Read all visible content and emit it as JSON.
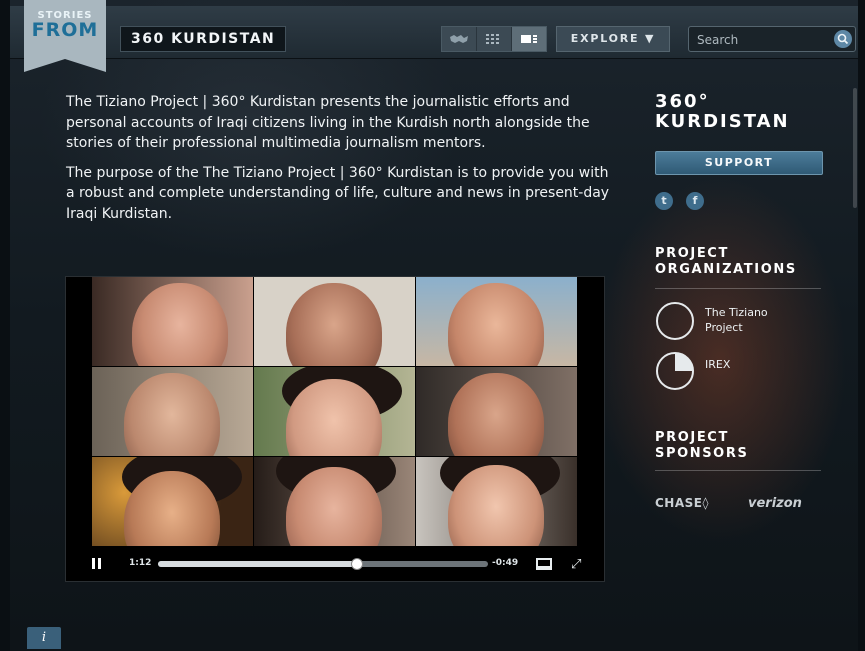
{
  "header": {
    "badge_top": "STORIES",
    "badge_bottom": "FROM",
    "site_title": "360 KURDISTAN",
    "view_modes": [
      {
        "name": "map-view",
        "icon": "map-icon"
      },
      {
        "name": "grid-view",
        "icon": "grid-icon"
      },
      {
        "name": "list-view",
        "icon": "list-icon",
        "active": true
      }
    ],
    "explore_label": "EXPLORE ▼",
    "search_placeholder": "Search",
    "search_icon": "magnifier-icon"
  },
  "main": {
    "paragraphs": [
      "The Tiziano Project | 360° Kurdistan presents the journalistic efforts and personal accounts of Iraqi citizens living in the Kurdish north alongside the stories of their professional multimedia journalism mentors.",
      "The purpose of the The Tiziano Project | 360° Kurdistan is to provide you with a robust and complete understanding of life, culture and news in present-day Iraqi Kurdistan."
    ],
    "video": {
      "elapsed": "1:12",
      "remaining": "-0:49",
      "progress": 0.6
    }
  },
  "sidebar": {
    "title_line1": "360°",
    "title_line2": "KURDISTAN",
    "support_label": "SUPPORT",
    "social": [
      {
        "name": "twitter-icon",
        "glyph": "t"
      },
      {
        "name": "facebook-icon",
        "glyph": "f"
      }
    ],
    "organizations_heading_1": "PROJECT",
    "organizations_heading_2": "ORGANIZATIONS",
    "organizations": [
      {
        "line1": "The Tiziano",
        "line2": "Project"
      },
      {
        "line1": "IREX",
        "line2": ""
      }
    ],
    "sponsors_heading_1": "PROJECT",
    "sponsors_heading_2": "SPONSORS",
    "sponsors": [
      "CHASE◊",
      "verizon"
    ]
  },
  "footer": {
    "info_label": "i"
  }
}
